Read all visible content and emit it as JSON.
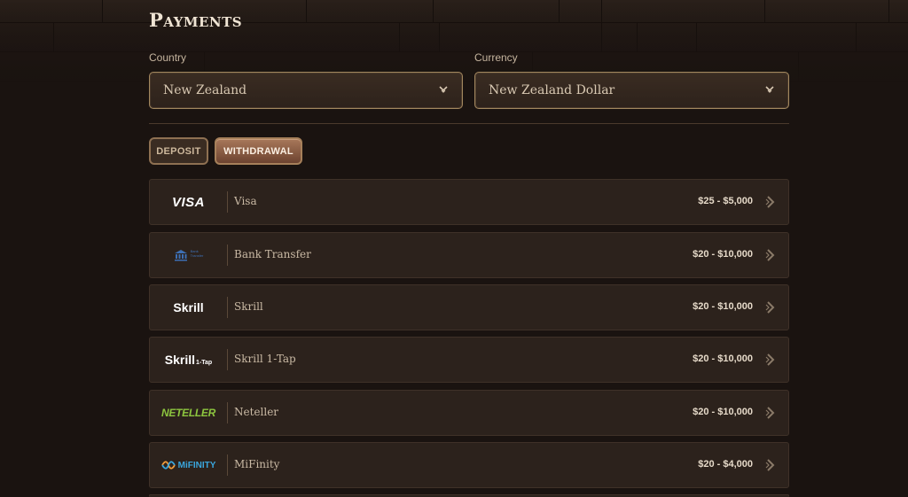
{
  "page": {
    "title": "Payments"
  },
  "filters": {
    "country": {
      "label": "Country",
      "value": "New Zealand"
    },
    "currency": {
      "label": "Currency",
      "value": "New Zealand Dollar"
    }
  },
  "tabs": [
    {
      "label": "DEPOSIT",
      "active": false
    },
    {
      "label": "WITHDRAWAL",
      "active": true
    }
  ],
  "methods": [
    {
      "logo": "VISA",
      "name": "Visa",
      "range": "$25 - $5,000",
      "icon": "visa-logo"
    },
    {
      "logo": "Bank Transfer",
      "name": "Bank Transfer",
      "range": "$20 - $10,000",
      "icon": "bank-logo"
    },
    {
      "logo": "Skrill",
      "name": "Skrill",
      "range": "$20 - $10,000",
      "icon": "skrill-logo"
    },
    {
      "logo": "Skrill 1-Tap",
      "name": "Skrill 1-Tap",
      "range": "$20 - $10,000",
      "icon": "skrill-1tap-logo"
    },
    {
      "logo": "NETELLER",
      "name": "Neteller",
      "range": "$20 - $10,000",
      "icon": "neteller-logo"
    },
    {
      "logo": "MiFINITY",
      "name": "MiFinity",
      "range": "$20 - $4,000",
      "icon": "mifinity-logo"
    }
  ],
  "colors": {
    "background": "#1a1310",
    "row_background": "#2c221c",
    "accent_gold": "#a2875e",
    "withdrawal_active": "#a8785a",
    "neteller_green": "#8dc63f",
    "mifinity_blue": "#3aa6dd"
  }
}
